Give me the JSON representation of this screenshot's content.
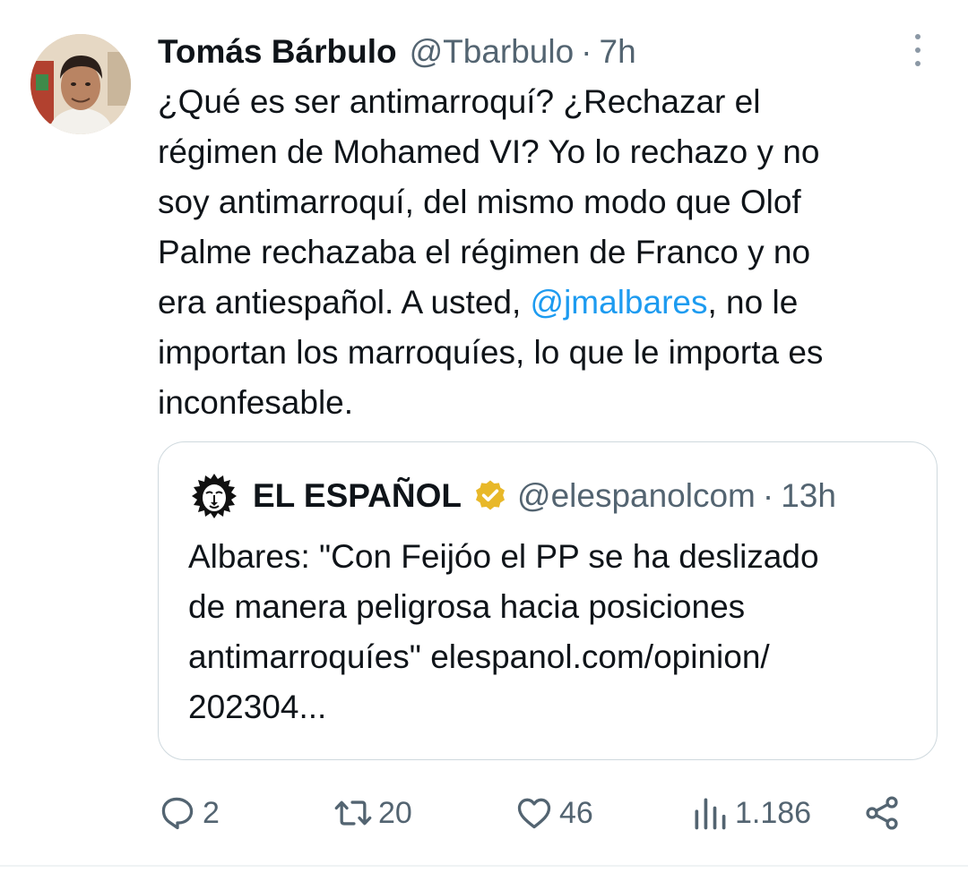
{
  "tweet": {
    "author_name": "Tomás Bárbulo",
    "author_handle": "@Tbarbulo",
    "separator": "·",
    "time": "7h",
    "text_lines": [
      "¿Qué es ser antimarroquí? ¿Rechazar el",
      "régimen de Mohamed VI? Yo lo rechazo y no",
      "soy antimarroquí, del mismo modo que Olof",
      "Palme rechazaba el régimen de Franco y no"
    ],
    "text_line5_before": "era antiespañol. A usted, ",
    "mention": "@jmalbares",
    "text_line5_after": ", no le",
    "text_line6": "importan los marroquíes, lo que le importa es",
    "text_line7": "inconfesable."
  },
  "quote": {
    "name": "EL ESPAÑOL",
    "handle": "@elespanolcom",
    "separator": "·",
    "time": "13h",
    "text_lines": [
      "Albares: \"Con Feijóo el PP se ha deslizado",
      "de manera peligrosa hacia posiciones",
      "antimarroquíes\" elespanol.com/opinion/",
      "202304..."
    ],
    "verified_icon": "gold-verified-badge-icon"
  },
  "actions": {
    "replies": "2",
    "retweets": "20",
    "likes": "46",
    "views": "1.186"
  },
  "colors": {
    "text": "#0f1419",
    "secondary": "#536471",
    "link": "#1d9bf0",
    "border": "#cfd9de",
    "verified_gold": "#e8b829"
  }
}
